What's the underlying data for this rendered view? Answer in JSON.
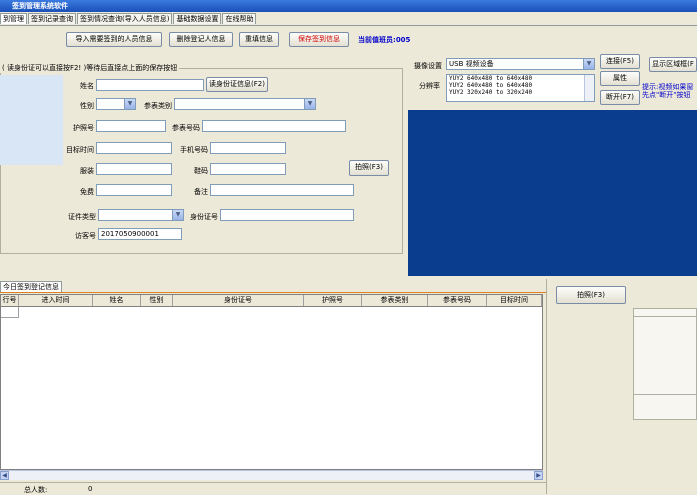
{
  "window": {
    "title": "签到管理系统软件"
  },
  "tabs": [
    "到管理",
    "签到记录查询",
    "签到情况查询(导入人员信息)",
    "基础数据设置",
    "在线帮助"
  ],
  "toolbar": {
    "import_button": "导入需要签到的人员信息",
    "delete_button": "删除登记人信息",
    "reset_button": "重填信息",
    "save_button": "保存签到信息",
    "duty_label": "当前值班员:",
    "duty_value": "005"
  },
  "form": {
    "group_title": "( 读身份证可以直接按F2! )等待后直接点上面的保存按钮",
    "name_label": "姓名",
    "read_id_button": "读身份证信息(F2)",
    "gender_label": "性别",
    "visitor_type_label": "参表类别",
    "passport_label": "护照号",
    "visitor_code_label": "参表号码",
    "target_time_label": "目标时间",
    "phone_label": "手机号码",
    "clothing_label": "服装",
    "size_label": "鞋码",
    "photo_button": "拍照(F3)",
    "position_label": "免费",
    "remark_label": "备注",
    "id_type_label": "证件类型",
    "id_number_label": "身份证号",
    "visit_no_label": "访客号",
    "visit_no_value": "2017050900001"
  },
  "camera": {
    "device_label": "摄像设置",
    "device_value": "USB 视频设备",
    "resolution_label": "分辨率",
    "resolutions": [
      "YUY2 640x480 to 640x480",
      "YUY2 640x480 to 640x480",
      "YUY2 320x240 to 320x240"
    ],
    "connect_button": "连接(F5)",
    "props_button": "属性",
    "disconnect_button": "断开(F7)",
    "display_button": "显示区域框(F",
    "hint_line1": "提示:视频如果窗",
    "hint_line2": "先点\"断开\"按钮"
  },
  "today": {
    "tab_label": "今日签到登记信息",
    "columns": [
      "行号",
      "进入时间",
      "姓名",
      "性别",
      "身份证号",
      "护照号",
      "参表类别",
      "参表号码",
      "目标时间"
    ],
    "total_label": "总人数:",
    "total_value": "0",
    "photo_button": "拍照(F3)"
  }
}
